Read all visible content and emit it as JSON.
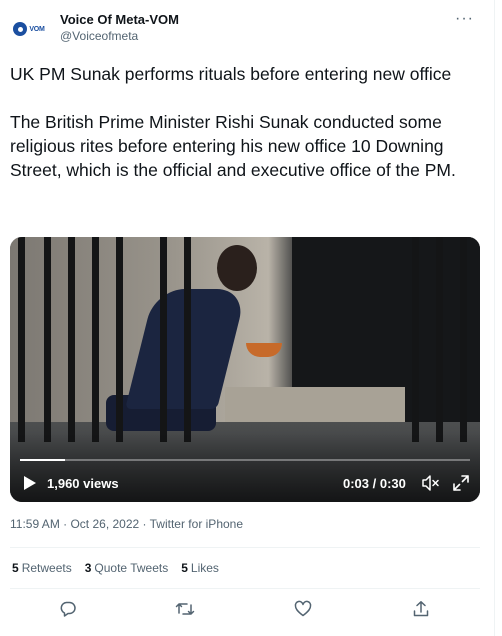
{
  "account": {
    "avatar_text": "VOM",
    "name": "Voice Of Meta-VOM",
    "handle": "@Voiceofmeta",
    "more_icon": "more-horizontal-icon"
  },
  "tweet": {
    "text": "UK PM Sunak performs rituals before entering new office\n\nThe British Prime Minister Rishi Sunak conducted some religious rites before entering his new office 10 Downing Street, which is the official and executive office of the PM."
  },
  "video": {
    "views": "1,960 views",
    "time": "0:03 / 0:30",
    "progress": 0.1,
    "play_icon": "play-icon",
    "mute_icon": "volume-muted-icon",
    "fullscreen_icon": "fullscreen-icon"
  },
  "meta": {
    "timestamp": "11:59 AM · Oct 26, 2022 · Twitter for iPhone"
  },
  "stats": {
    "retweets_count": "5",
    "retweets_label": "Retweets",
    "quotes_count": "3",
    "quotes_label": "Quote Tweets",
    "likes_count": "5",
    "likes_label": "Likes"
  },
  "actions": {
    "reply_icon": "reply-icon",
    "retweet_icon": "retweet-icon",
    "like_icon": "heart-icon",
    "share_icon": "share-icon"
  },
  "colors": {
    "text_primary": "#0f1419",
    "text_secondary": "#536471",
    "divider": "#eff3f4"
  }
}
